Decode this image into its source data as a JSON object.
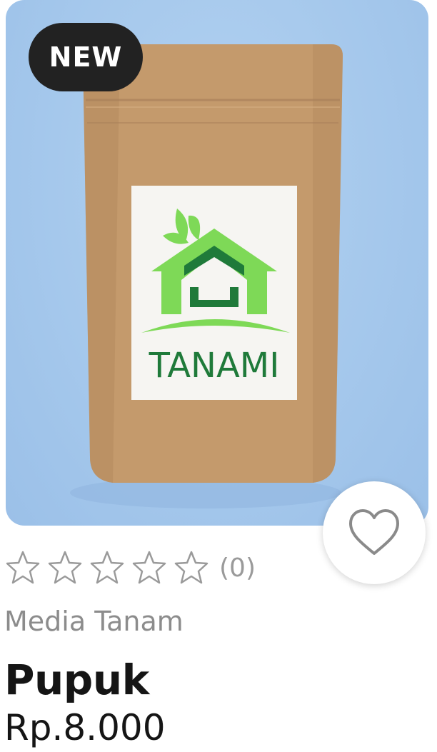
{
  "product": {
    "badge": "NEW",
    "image": {
      "label_text": "TANAMI",
      "colors": {
        "background": "#a9cbee",
        "pouch": "#c49a6c",
        "label": "#f6f5f2",
        "logo_light_green": "#7ed957",
        "logo_dark_green": "#1f7a3a"
      }
    },
    "rating": {
      "stars_total": 5,
      "stars_filled": 0,
      "review_count_text": "(0)"
    },
    "category": "Media Tanam",
    "name": "Pupuk",
    "price": "Rp.8.000",
    "wishlist_icon": "heart-outline-icon"
  }
}
